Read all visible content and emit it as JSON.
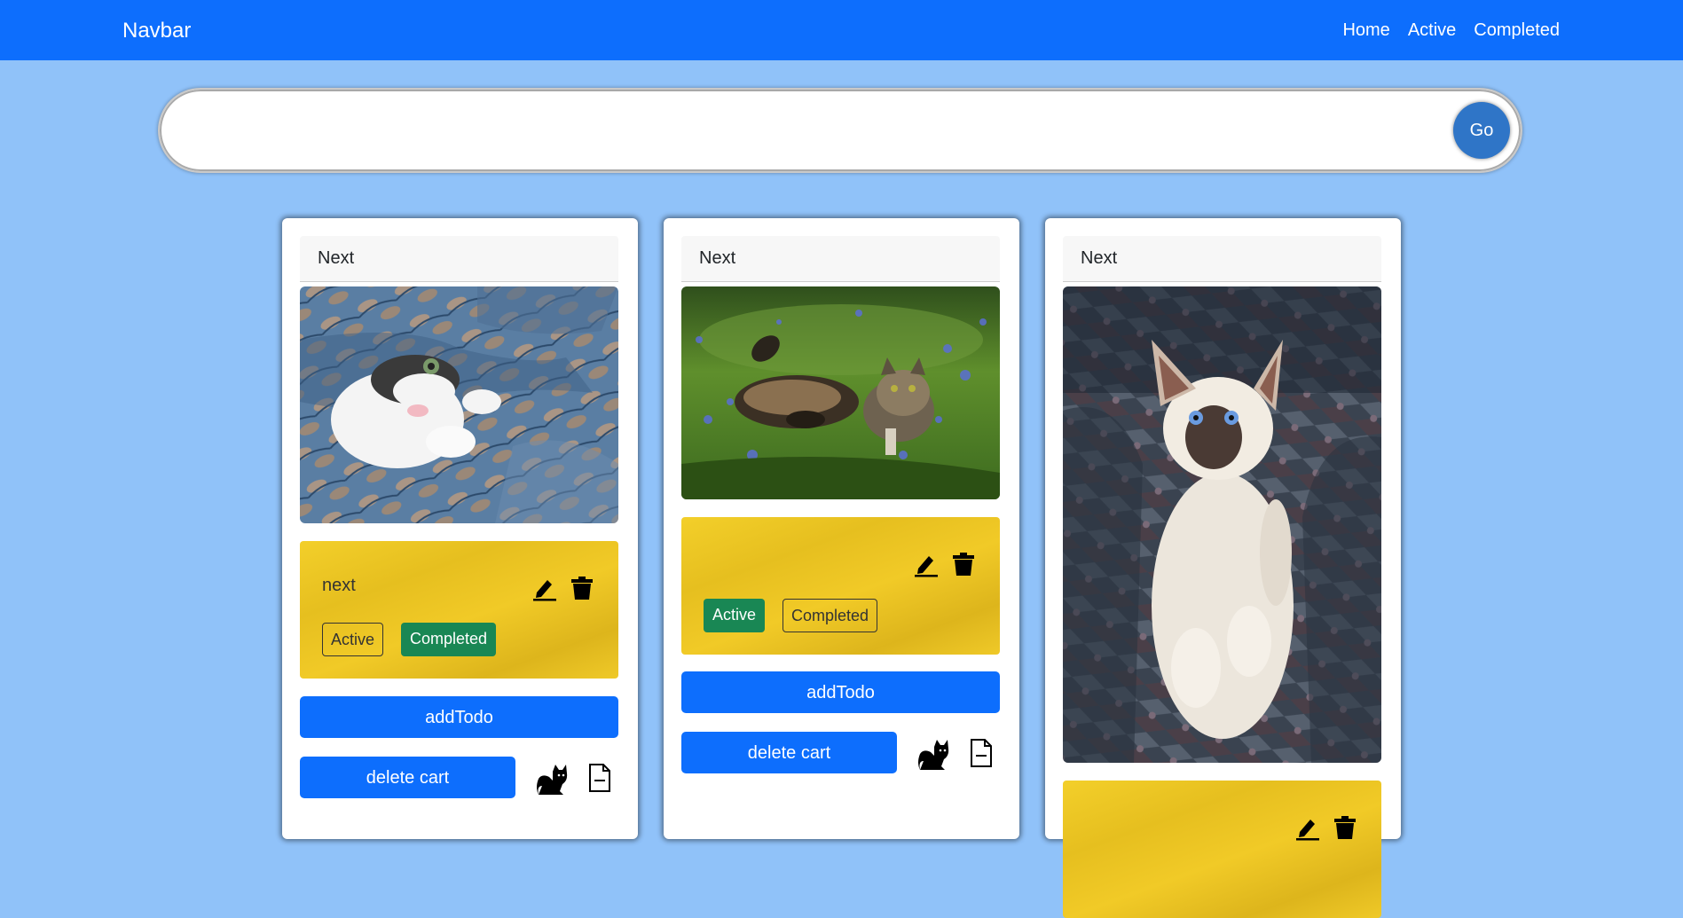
{
  "navbar": {
    "brand": "Navbar",
    "links": [
      "Home",
      "Active",
      "Completed"
    ]
  },
  "search": {
    "value": "",
    "placeholder": "",
    "button_label": "Go"
  },
  "cards": [
    {
      "header": "Next",
      "photo": "cat hiding in blue patterned blanket",
      "todo": {
        "text": "next",
        "status": "Completed"
      },
      "badges": [
        "Active",
        "Completed"
      ],
      "add_label": "addTodo",
      "delete_label": "delete cart"
    },
    {
      "header": "Next",
      "photo": "two tabby cats playing in grass with blue flowers",
      "todo": {
        "text": "",
        "status": "Active"
      },
      "badges": [
        "Active",
        "Completed"
      ],
      "add_label": "addTodo",
      "delete_label": "delete cart"
    },
    {
      "header": "Next",
      "photo": "fluffy white cat with dark face sitting on patterned armchair"
    }
  ],
  "colors": {
    "page_bg": "#90c2f9",
    "navbar_bg": "#0d6efd",
    "primary": "#0d6efd",
    "success": "#198754",
    "todo_bg": "#f1ca27",
    "go_button": "#2f75c7"
  },
  "icons": [
    "edit-icon",
    "trash-icon",
    "cat-icon",
    "file-minus-icon"
  ]
}
